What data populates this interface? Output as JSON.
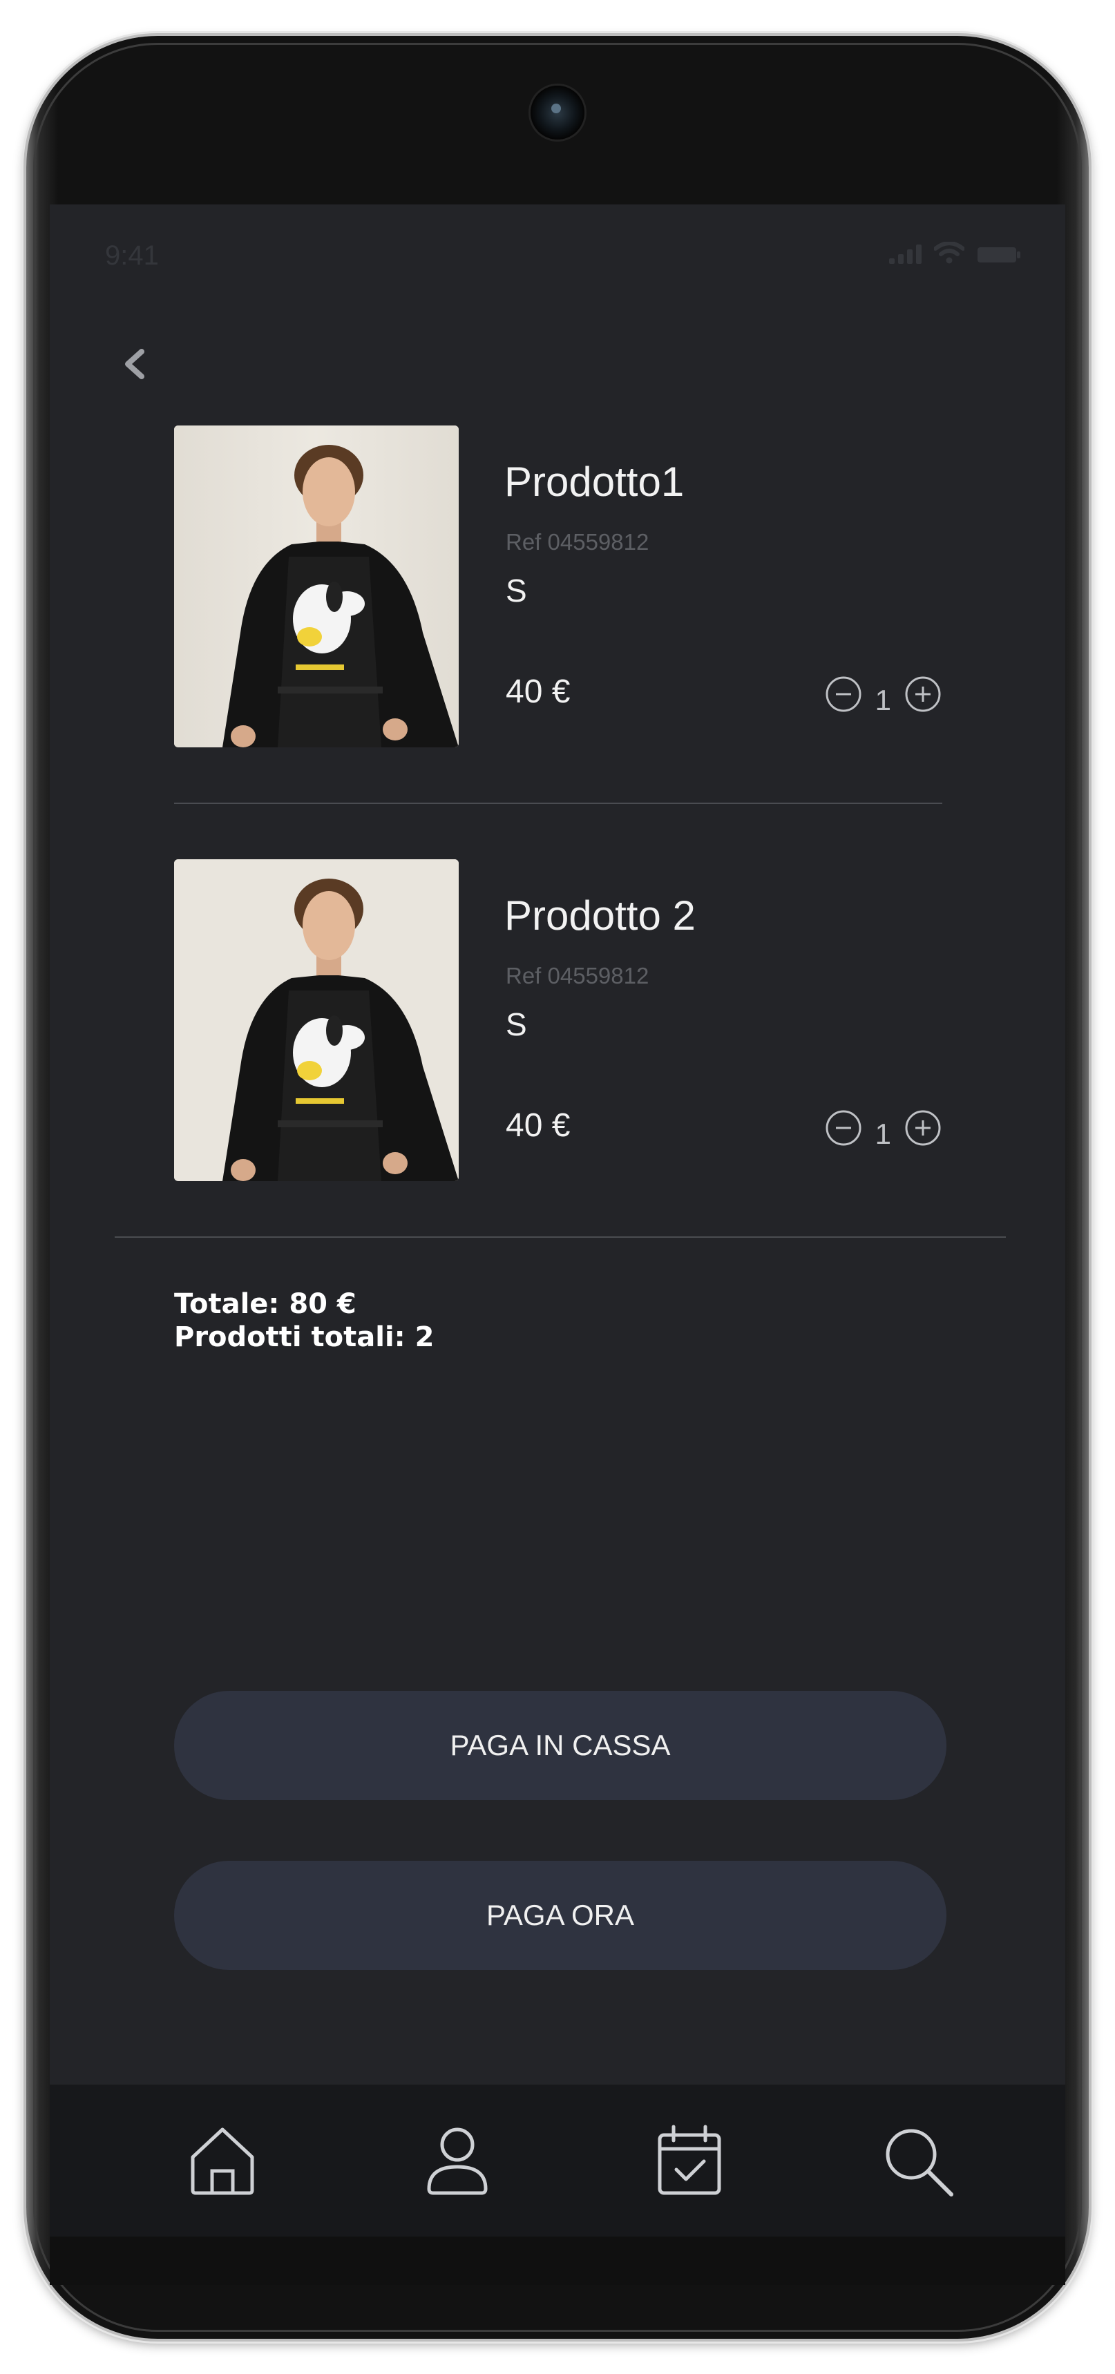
{
  "status_bar": {
    "time": "9:41"
  },
  "header": {
    "back_icon": "chevron-left-icon"
  },
  "cart": {
    "items": [
      {
        "name": "Prodotto1",
        "ref": "Ref 04559812",
        "size": "S",
        "price": "40 €",
        "quantity": "1",
        "image": "model in black jacket and Snoopy t-shirt"
      },
      {
        "name": "Prodotto 2",
        "ref": "Ref 04559812",
        "size": "S",
        "price": "40 €",
        "quantity": "1",
        "image": "model in black jacket and Snoopy t-shirt"
      }
    ]
  },
  "summary": {
    "total": "Totale: 80 €",
    "total_products": "Prodotti totali: 2"
  },
  "actions": {
    "pay_in_store": "PAGA IN CASSA",
    "pay_now": "PAGA ORA"
  },
  "bottom_nav": {
    "items": [
      {
        "icon": "home-icon"
      },
      {
        "icon": "user-icon"
      },
      {
        "icon": "calendar-check-icon"
      },
      {
        "icon": "search-icon"
      }
    ]
  },
  "colors": {
    "screen_bg": "#232428",
    "button_bg": "#2f3340",
    "nav_bg": "#17181b",
    "text": "#f2f2f2",
    "muted_text": "#5d5f64"
  }
}
